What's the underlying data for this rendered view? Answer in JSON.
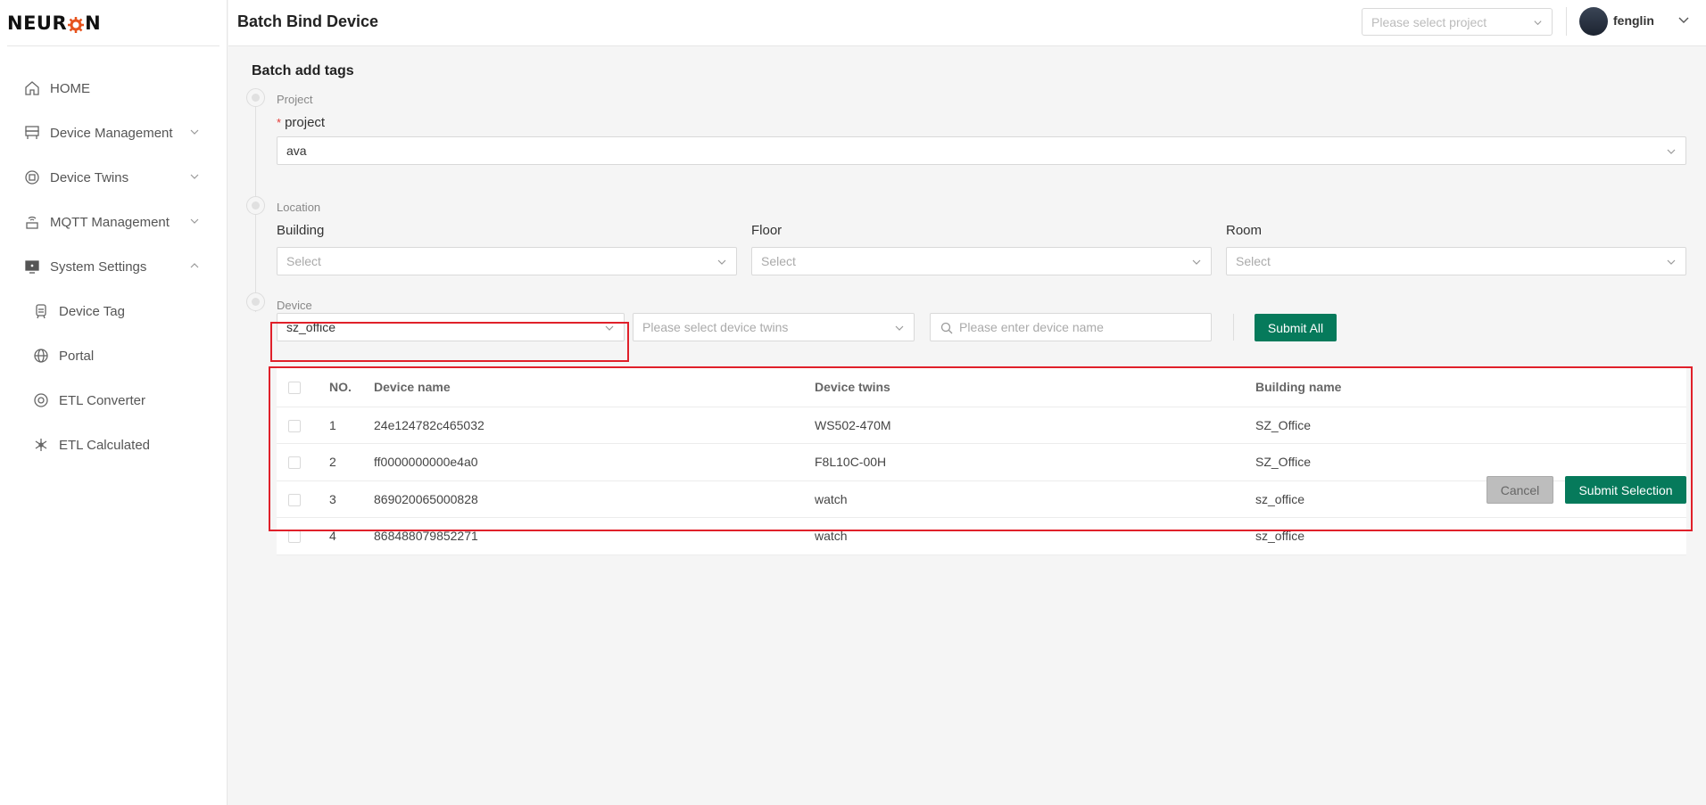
{
  "app": {
    "logo_text_left": "NEUR",
    "logo_text_right": "N",
    "brand_color": "#e6531d"
  },
  "sidebar": {
    "items": [
      {
        "label": "HOME",
        "icon": "home-icon"
      },
      {
        "label": "Device Management",
        "icon": "server-icon",
        "expanded": false
      },
      {
        "label": "Device Twins",
        "icon": "twins-icon",
        "expanded": false
      },
      {
        "label": "MQTT Management",
        "icon": "signal-icon",
        "expanded": false
      },
      {
        "label": "System Settings",
        "icon": "monitor-icon",
        "expanded": true
      }
    ],
    "sub_items": [
      {
        "label": "Device Tag",
        "icon": "tag-icon"
      },
      {
        "label": "Portal",
        "icon": "globe-icon"
      },
      {
        "label": "ETL Converter",
        "icon": "converter-icon"
      },
      {
        "label": "ETL Calculated",
        "icon": "calc-icon"
      }
    ]
  },
  "header": {
    "title": "Batch Bind Device",
    "project_placeholder": "Please select project",
    "user_name": "fenglin"
  },
  "main": {
    "section_title": "Batch add tags",
    "steps": {
      "project": {
        "label": "Project",
        "field_label": "project",
        "required_mark": "*",
        "value": "ava"
      },
      "location": {
        "label": "Location",
        "building_label": "Building",
        "floor_label": "Floor",
        "room_label": "Room",
        "building_placeholder": "Select",
        "floor_placeholder": "Select",
        "room_placeholder": "Select"
      },
      "device": {
        "label": "Device",
        "building_value": "sz_office",
        "twins_placeholder": "Please select device twins",
        "name_placeholder": "Please enter device name",
        "submit_all_label": "Submit All"
      }
    },
    "table": {
      "columns": [
        "NO.",
        "Device name",
        "Device twins",
        "Building name"
      ],
      "rows": [
        {
          "no": "1",
          "name": "24e124782c465032",
          "twins": "WS502-470M",
          "building": "SZ_Office"
        },
        {
          "no": "2",
          "name": "ff0000000000e4a0",
          "twins": "F8L10C-00H",
          "building": "SZ_Office"
        },
        {
          "no": "3",
          "name": "869020065000828",
          "twins": "watch",
          "building": "sz_office"
        },
        {
          "no": "4",
          "name": "868488079852271",
          "twins": "watch",
          "building": "sz_office"
        }
      ]
    },
    "footer": {
      "cancel_label": "Cancel",
      "submit_selection_label": "Submit Selection"
    }
  },
  "colors": {
    "primary_button": "#067a5b",
    "highlight_box": "#e0202a"
  }
}
